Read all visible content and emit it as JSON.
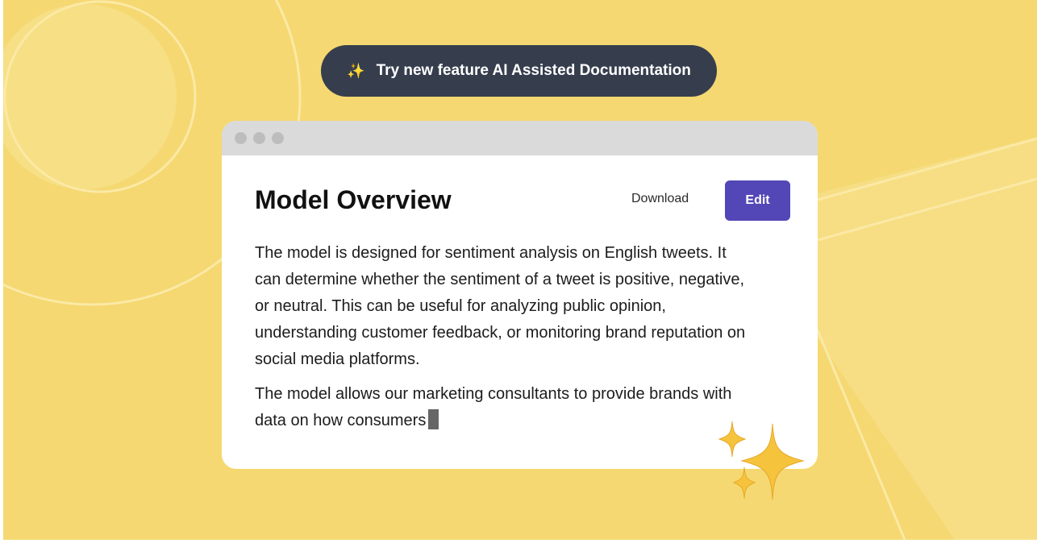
{
  "banner": {
    "icon": "sparkles-icon",
    "text": "Try new feature AI Assisted Documentation"
  },
  "window": {
    "title": "Model Overview",
    "download_label": "Download",
    "edit_label": "Edit",
    "paragraphs": [
      "The model is designed for sentiment analysis on English tweets. It can determine whether the sentiment of a tweet is positive, negative, or neutral. This can be useful for analyzing public opinion, understanding customer feedback, or monitoring brand reputation on social media platforms.",
      "The model allows our marketing consultants to provide brands with data on how consumers"
    ]
  },
  "colors": {
    "background": "#f5d871",
    "banner": "#363e4e",
    "accent": "#5346b7"
  }
}
